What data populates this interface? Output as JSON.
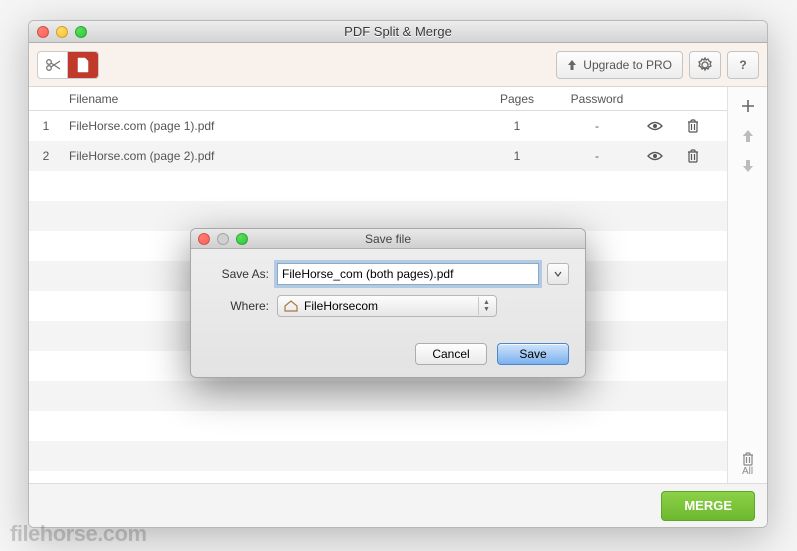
{
  "window": {
    "title": "PDF Split & Merge"
  },
  "toolbar": {
    "upgrade_label": "Upgrade to PRO"
  },
  "table": {
    "headers": {
      "filename": "Filename",
      "pages": "Pages",
      "password": "Password"
    },
    "rows": [
      {
        "idx": "1",
        "name": "FileHorse.com (page 1).pdf",
        "pages": "1",
        "password": "-"
      },
      {
        "idx": "2",
        "name": "FileHorse.com (page 2).pdf",
        "pages": "1",
        "password": "-"
      }
    ]
  },
  "sidebar": {
    "all_label": "All"
  },
  "footer": {
    "merge_label": "MERGE"
  },
  "dialog": {
    "title": "Save file",
    "save_as_label": "Save As:",
    "save_as_value": "FileHorse_com (both pages).pdf",
    "where_label": "Where:",
    "where_value": "FileHorsecom",
    "cancel_label": "Cancel",
    "save_label": "Save"
  },
  "watermark": "filehorse.com"
}
